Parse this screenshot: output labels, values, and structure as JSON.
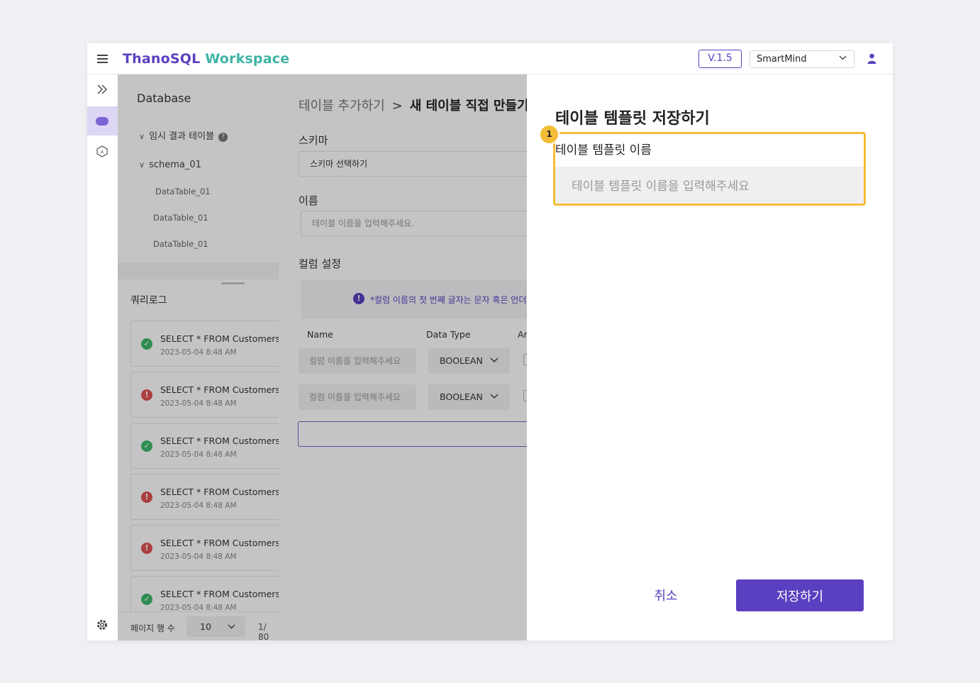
{
  "header": {
    "logo_part1": "ThanoSQL",
    "logo_part2": "Workspace",
    "version": "V.1.5",
    "org_selected": "SmartMind"
  },
  "sidebar": {
    "title": "Database",
    "temp_tables_label": "임시 결과 테이블",
    "help_badge": "?",
    "schema_name": "schema_01",
    "tables": [
      "DataTable_01",
      "DataTable_01",
      "DataTable_01"
    ]
  },
  "querylog": {
    "title": "쿼리로그",
    "items": [
      {
        "status": "success",
        "sql": "SELECT * FROM Customers...",
        "time": "2023-05-04 8:48 AM"
      },
      {
        "status": "error",
        "sql": "SELECT * FROM Customers...",
        "time": "2023-05-04 8:48 AM"
      },
      {
        "status": "success",
        "sql": "SELECT * FROM Customers...",
        "time": "2023-05-04 8:48 AM"
      },
      {
        "status": "error",
        "sql": "SELECT * FROM Customers...",
        "time": "2023-05-04 8:48 AM"
      },
      {
        "status": "error",
        "sql": "SELECT * FROM Customers...",
        "time": "2023-05-04 8:48 AM"
      },
      {
        "status": "success",
        "sql": "SELECT * FROM Customers...",
        "time": "2023-05-04 8:48 AM"
      }
    ],
    "status_ok_glyph": "✓",
    "status_err_glyph": "!"
  },
  "pager": {
    "label": "페이지 행 수",
    "rows_per_page": "10",
    "pages": "1/ 80"
  },
  "main": {
    "breadcrumb_parent": "테이블 추가하기",
    "breadcrumb_sep": ">",
    "breadcrumb_current": "새 테이블 직접 만들기",
    "schema_label": "스키마",
    "schema_value": "스키마 선택하기",
    "name_label": "이름",
    "name_placeholder": "테이블 이름을 입력해주세요.",
    "columns_label": "컬럼 설정",
    "notice_icon": "!",
    "notice_text": "*컬럼 이름의 첫 번째 글자는 문자 혹은 언더바(_)로 시작해야 합니다.",
    "col_headers": {
      "name": "Name",
      "type": "Data Type",
      "array": "Array"
    },
    "rows": [
      {
        "name_placeholder": "컬럼 이름을 입력해주세요",
        "type": "BOOLEAN"
      },
      {
        "name_placeholder": "컬럼 이름을 입력해주세요",
        "type": "BOOLEAN"
      }
    ]
  },
  "modal": {
    "title": "테이블 템플릿 저장하기",
    "field_label": "테이블 템플릿 이름",
    "field_placeholder": "테이블 템플릿 이름을 입력해주세요",
    "field_value": "",
    "annotation_badge": "1",
    "cancel_label": "취소",
    "save_label": "저장하기"
  },
  "colors": {
    "accent": "#5a3fc0",
    "logo_teal": "#3fb3a5",
    "highlight": "#f3bd38",
    "success": "#3db86b",
    "error": "#e05353"
  }
}
